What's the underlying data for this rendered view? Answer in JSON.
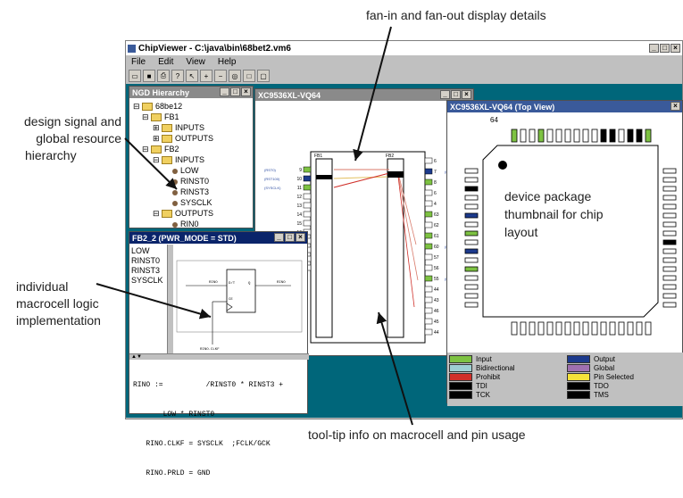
{
  "callouts": {
    "top": "fan-in and fan-out display details",
    "left1": "design signal and",
    "left2": "global resource",
    "left3": "hierarchy",
    "left4": "individual",
    "left5": "macrocell logic",
    "left6": "implementation",
    "right1": "device package",
    "right2": "thumbnail for chip",
    "right3": "layout",
    "bottom": "tool-tip info on macrocell and pin usage"
  },
  "app": {
    "title": "ChipViewer - C:\\java\\bin\\68bet2.vm6",
    "menu": [
      "File",
      "Edit",
      "View",
      "Help"
    ]
  },
  "ngd": {
    "title": "NGD Hierarchy",
    "tree": [
      "68be12",
      "FB1",
      "INPUTS",
      "OUTPUTS",
      "FB2",
      "INPUTS",
      "LOW",
      "RINST0",
      "RINST3",
      "SYSCLK",
      "OUTPUTS",
      "RIN0"
    ]
  },
  "chip": {
    "title": "XC9536XL-VQ64",
    "fb_left": "FB1",
    "fb_right": "FB2",
    "left_pins": [
      "9",
      "10",
      "11",
      "12",
      "13",
      "14",
      "15",
      "16",
      "17",
      "18",
      "19",
      "20"
    ],
    "right_pins": [
      "6",
      "7",
      "8",
      "6",
      "4",
      "63",
      "62",
      "61",
      "60",
      "57",
      "56",
      "55",
      "44",
      "43",
      "46",
      "45",
      "44"
    ],
    "left_tags": [
      "(RST0)",
      "(RST100)",
      "(SYSCLK)"
    ],
    "right_tags": [
      "(RIN0)",
      "(LOW)",
      "(RIN3)"
    ]
  },
  "package": {
    "title": "XC9536XL-VQ64 (Top View)",
    "pin_label": "64"
  },
  "legend": [
    {
      "label": "Input",
      "color": "#7dc242"
    },
    {
      "label": "Bidirectional",
      "color": "#9ecfd2"
    },
    {
      "label": "Prohibit",
      "color": "#d0302a"
    },
    {
      "label": "TDI",
      "color": "#000000"
    },
    {
      "label": "TCK",
      "color": "#000000"
    },
    {
      "label": "Output",
      "color": "#1c3a8c"
    },
    {
      "label": "Global",
      "color": "#a070b0"
    },
    {
      "label": "Pin Selected",
      "color": "#f5e23a"
    },
    {
      "label": "TDO",
      "color": "#000000"
    },
    {
      "label": "TMS",
      "color": "#000000"
    }
  ],
  "macro": {
    "title": "FB2_2 (PWR_MODE = STD)",
    "signals": [
      "LOW",
      "RINST0",
      "RINST3",
      "SYSCLK"
    ],
    "equation": [
      "RINO :=          /RINST0 * RINST3 +",
      "       LOW * RINST0",
      "   RINO.CLKF = SYSCLK  ;FCLK/GCK",
      "   RINO.PRLD = GND"
    ],
    "ff_labels": [
      "RINO",
      "D/T",
      "Q",
      "CE",
      "RINO"
    ],
    "clk_label": "RINO.CLKF"
  }
}
